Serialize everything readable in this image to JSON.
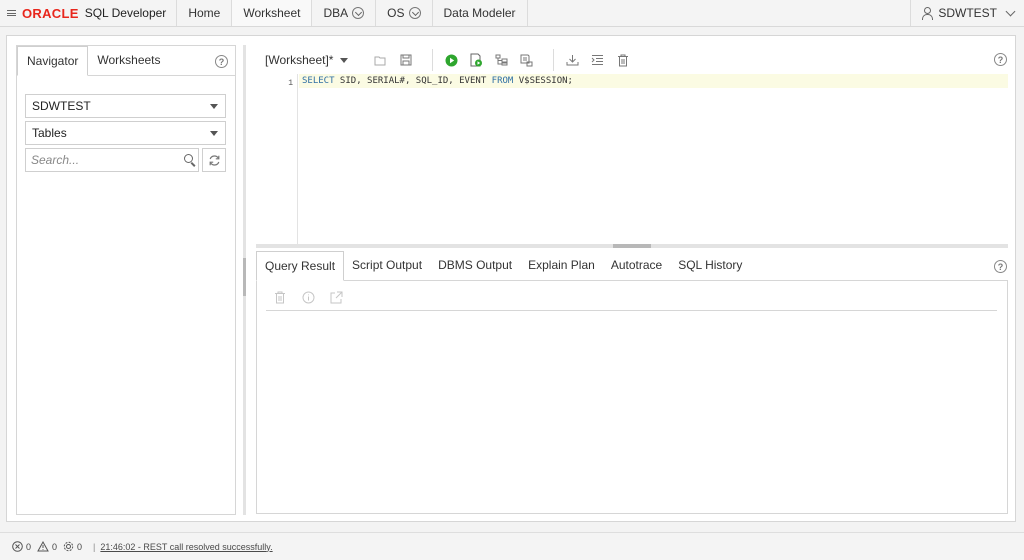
{
  "app": {
    "brand": "ORACLE",
    "product": "SQL Developer",
    "brand_color": "#e8261c"
  },
  "topnav": {
    "items": [
      {
        "label": "Home"
      },
      {
        "label": "Worksheet"
      },
      {
        "label": "DBA"
      },
      {
        "label": "OS"
      },
      {
        "label": "Data Modeler"
      }
    ],
    "active": "Worksheet",
    "user": "SDWTEST"
  },
  "navigator": {
    "tabs": [
      "Navigator",
      "Worksheets"
    ],
    "active_tab": "Navigator",
    "connection": "SDWTEST",
    "object_type": "Tables",
    "search_placeholder": "Search..."
  },
  "worksheet": {
    "title": "[Worksheet]*",
    "toolbar_icons": [
      "folder-icon",
      "save-icon",
      "run-statement-icon",
      "run-script-icon",
      "explain-plan-icon",
      "autotrace-icon",
      "download-icon",
      "format-icon",
      "trash-icon"
    ],
    "run_color": "#2ea62e"
  },
  "editor": {
    "line_number": "1",
    "code_parts": {
      "kw1": "SELECT",
      "cols": " SID, SERIAL#, SQL_ID, EVENT ",
      "kw2": "FROM",
      "table": " V$SESSION;"
    }
  },
  "results": {
    "tabs": [
      "Query Result",
      "Script Output",
      "DBMS Output",
      "Explain Plan",
      "Autotrace",
      "SQL History"
    ],
    "active_tab": "Query Result",
    "tool_icons": [
      "trash-icon",
      "info-icon",
      "external-link-icon"
    ]
  },
  "statusbar": {
    "errors": "0",
    "warnings": "0",
    "tasks": "0",
    "message": "21:46:02 - REST call resolved successfully."
  }
}
